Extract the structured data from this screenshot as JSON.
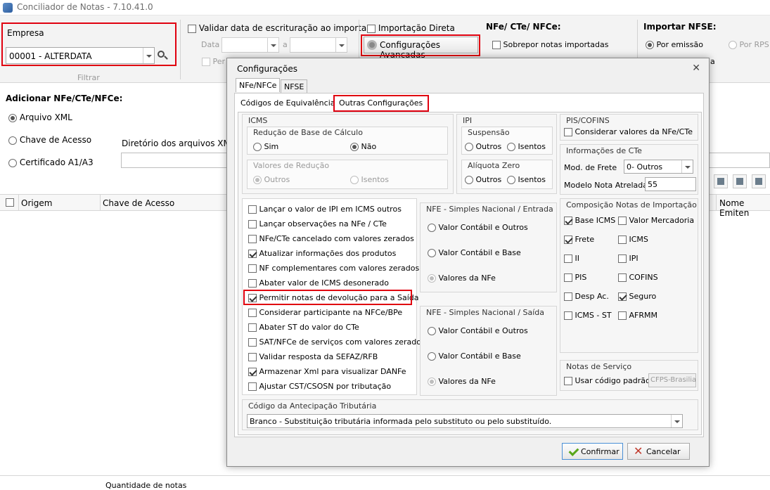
{
  "window": {
    "title": "Conciliador de Notas - 7.10.41.0"
  },
  "ribbon": {
    "empresa_label": "Empresa",
    "empresa_value": "00001 - ALTERDATA",
    "filtrar_label": "Filtrar",
    "validar_data_label": "Validar data de escrituração ao importar",
    "data_label": "Data",
    "a_label": "a",
    "per_label": "Per",
    "importacao_direta_label": "Importação Direta",
    "config_avancadas_label": "Configurações Avançadas",
    "nfe_header": "NFe/ CTe/ NFCe:",
    "sobrepor_label": "Sobrepor notas importadas",
    "importar_nfse_header": "Importar NFSE:",
    "por_emissao_label": "Por emissão",
    "por_rps_label": "Por RPS",
    "trailing_a": "a"
  },
  "main": {
    "adicionar_header": "Adicionar NFe/CTe/NFCe:",
    "arquivo_xml": "Arquivo XML",
    "chave_acesso": "Chave de Acesso",
    "certificado": "Certificado A1/A3",
    "diretorio_label": "Diretório dos arquivos XML:",
    "col_origem": "Origem",
    "col_chave": "Chave de Acesso",
    "col_nome_emitente": "Nome Emiten",
    "footer_text": "Quantidade de notas"
  },
  "dialog": {
    "title": "Configurações",
    "tabs": [
      "NFe/NFCe",
      "NFSE"
    ],
    "subtabs": [
      "Códigos de Equivalência",
      "Outras Configurações"
    ],
    "icms": {
      "title": "ICMS",
      "reducao_title": "Redução de Base de Cálculo",
      "sim": "Sim",
      "nao": "Não",
      "valores_reducao_title": "Valores de Redução",
      "outros": "Outros",
      "isentos": "Isentos"
    },
    "ipi": {
      "title": "IPI",
      "suspensao_title": "Suspensão",
      "outros": "Outros",
      "isentos": "Isentos",
      "aliquota_title": "Alíquota Zero",
      "outros2": "Outros",
      "isentos2": "Isentos"
    },
    "pis": {
      "title": "PIS/COFINS",
      "considerar": "Considerar valores da NFe/CTe"
    },
    "cte": {
      "title": "Informações de CTe",
      "mod_frete_label": "Mod. de Frete",
      "mod_frete_value": "0- Outros",
      "modelo_nota_label": "Modelo Nota Atrelada",
      "modelo_nota_value": "55"
    },
    "options": [
      {
        "label": "Lançar o valor de IPI em ICMS outros",
        "checked": false
      },
      {
        "label": "Lançar observações na NFe / CTe",
        "checked": false
      },
      {
        "label": "NFe/CTe cancelado com valores zerados",
        "checked": false
      },
      {
        "label": "Atualizar informações dos produtos",
        "checked": true
      },
      {
        "label": "NF complementares com valores zerados",
        "checked": false
      },
      {
        "label": "Abater valor de ICMS desonerado",
        "checked": false
      },
      {
        "label": "Permitir notas de devolução para a Saída",
        "checked": true
      },
      {
        "label": "Considerar participante na NFCe/BPe",
        "checked": false
      },
      {
        "label": "Abater ST do valor do CTe",
        "checked": false
      },
      {
        "label": "SAT/NFCe de serviços com valores zerados",
        "checked": false
      },
      {
        "label": "Validar resposta da SEFAZ/RFB",
        "checked": false
      },
      {
        "label": "Armazenar Xml para visualizar DANFe",
        "checked": true
      },
      {
        "label": "Ajustar CST/CSOSN por tributação",
        "checked": false
      }
    ],
    "sn_entrada": {
      "title": "NFE - Simples Nacional / Entrada",
      "opt1": "Valor Contábil e Outros",
      "opt2": "Valor Contábil e Base",
      "opt3": "Valores da NFe"
    },
    "sn_saida": {
      "title": "NFE - Simples Nacional / Saída",
      "opt1": "Valor Contábil e Outros",
      "opt2": "Valor Contábil e Base",
      "opt3": "Valores da NFe"
    },
    "composicao": {
      "title": "Composição Notas de Importação",
      "items": [
        {
          "label": "Base ICMS",
          "checked": true
        },
        {
          "label": "Valor Mercadoria",
          "checked": false
        },
        {
          "label": "Frete",
          "checked": true
        },
        {
          "label": "ICMS",
          "checked": false
        },
        {
          "label": "II",
          "checked": false
        },
        {
          "label": "IPI",
          "checked": false
        },
        {
          "label": "PIS",
          "checked": false
        },
        {
          "label": "COFINS",
          "checked": false
        },
        {
          "label": "Desp Ac.",
          "checked": false
        },
        {
          "label": "Seguro",
          "checked": true
        },
        {
          "label": "ICMS - ST",
          "checked": false
        },
        {
          "label": "AFRMM",
          "checked": false
        }
      ]
    },
    "servico": {
      "title": "Notas de Serviço",
      "usar_codigo": "Usar código padrão",
      "codigo_value": "CFPS-Brasilia"
    },
    "antecipacao": {
      "title": "Código da Antecipação Tributária",
      "value": "Branco - Substituição tributária informada pelo substituto ou pelo substituído."
    },
    "confirmar": "Confirmar",
    "cancelar": "Cancelar"
  },
  "colors": {
    "highlight": "#e0000f",
    "accent": "#58a61a"
  }
}
